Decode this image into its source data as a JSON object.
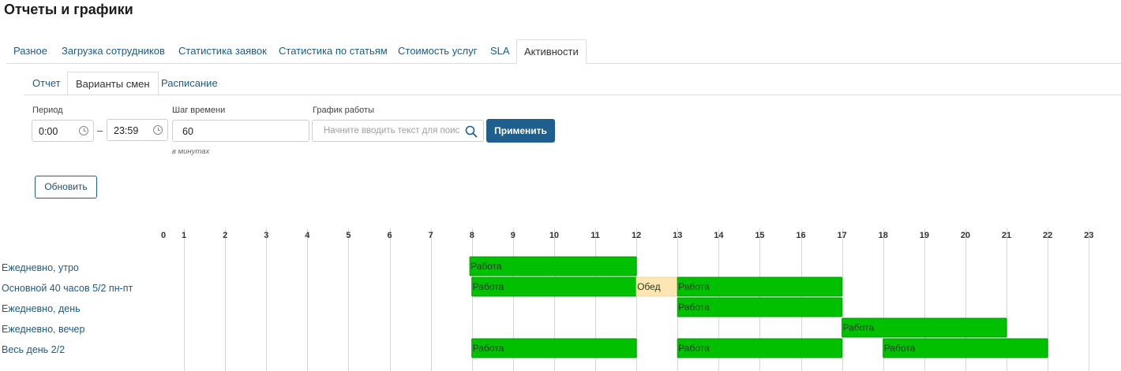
{
  "page": {
    "title": "Отчеты и графики"
  },
  "tabs": [
    "Разное",
    "Загрузка сотрудников",
    "Статистика заявок",
    "Статистика по статьям",
    "Стоимость услуг",
    "SLA",
    "Активности"
  ],
  "active_tab": "Активности",
  "subtabs": [
    "Отчет",
    "Варианты смен",
    "Расписание"
  ],
  "active_subtab": "Варианты смен",
  "filters": {
    "period_label": "Период",
    "period_from": "0:00",
    "period_sep": "–",
    "period_to": "23:59",
    "step_label": "Шаг времени",
    "step_value": "60",
    "step_hint": "в минутах",
    "schedule_label": "График работы",
    "schedule_placeholder": "Начните вводить текст для поиска",
    "apply_label": "Применить",
    "refresh_label": "Обновить"
  },
  "colors": {
    "accent": "#1f5f8e",
    "link": "#1a5c8a",
    "work": "#00c000",
    "lunch": "#fde6b4"
  },
  "chart_data": {
    "type": "gantt",
    "hours": [
      0,
      1,
      2,
      3,
      4,
      5,
      6,
      7,
      8,
      9,
      10,
      11,
      12,
      13,
      14,
      15,
      16,
      17,
      18,
      19,
      20,
      21,
      22,
      23
    ],
    "rows": [
      {
        "name": "Ежедневно, утро",
        "blocks": [
          {
            "label": "Работа",
            "start": 7.95,
            "end": 12,
            "kind": "work"
          }
        ]
      },
      {
        "name": "Основной 40 часов 5/2 пн-пт",
        "blocks": [
          {
            "label": "Работа",
            "start": 8,
            "end": 12,
            "kind": "work"
          },
          {
            "label": "Обед",
            "start": 12,
            "end": 13,
            "kind": "lunch"
          },
          {
            "label": "Работа",
            "start": 13,
            "end": 17,
            "kind": "work"
          }
        ]
      },
      {
        "name": "Ежедневно, день",
        "blocks": [
          {
            "label": "Работа",
            "start": 13,
            "end": 17,
            "kind": "work"
          }
        ]
      },
      {
        "name": "Ежедневно, вечер",
        "blocks": [
          {
            "label": "Работа",
            "start": 17,
            "end": 21,
            "kind": "work"
          }
        ]
      },
      {
        "name": "Весь день 2/2",
        "blocks": [
          {
            "label": "Работа",
            "start": 8,
            "end": 12,
            "kind": "work"
          },
          {
            "label": "Работа",
            "start": 13,
            "end": 17,
            "kind": "work"
          },
          {
            "label": "Работа",
            "start": 18,
            "end": 22,
            "kind": "work"
          }
        ]
      }
    ]
  }
}
